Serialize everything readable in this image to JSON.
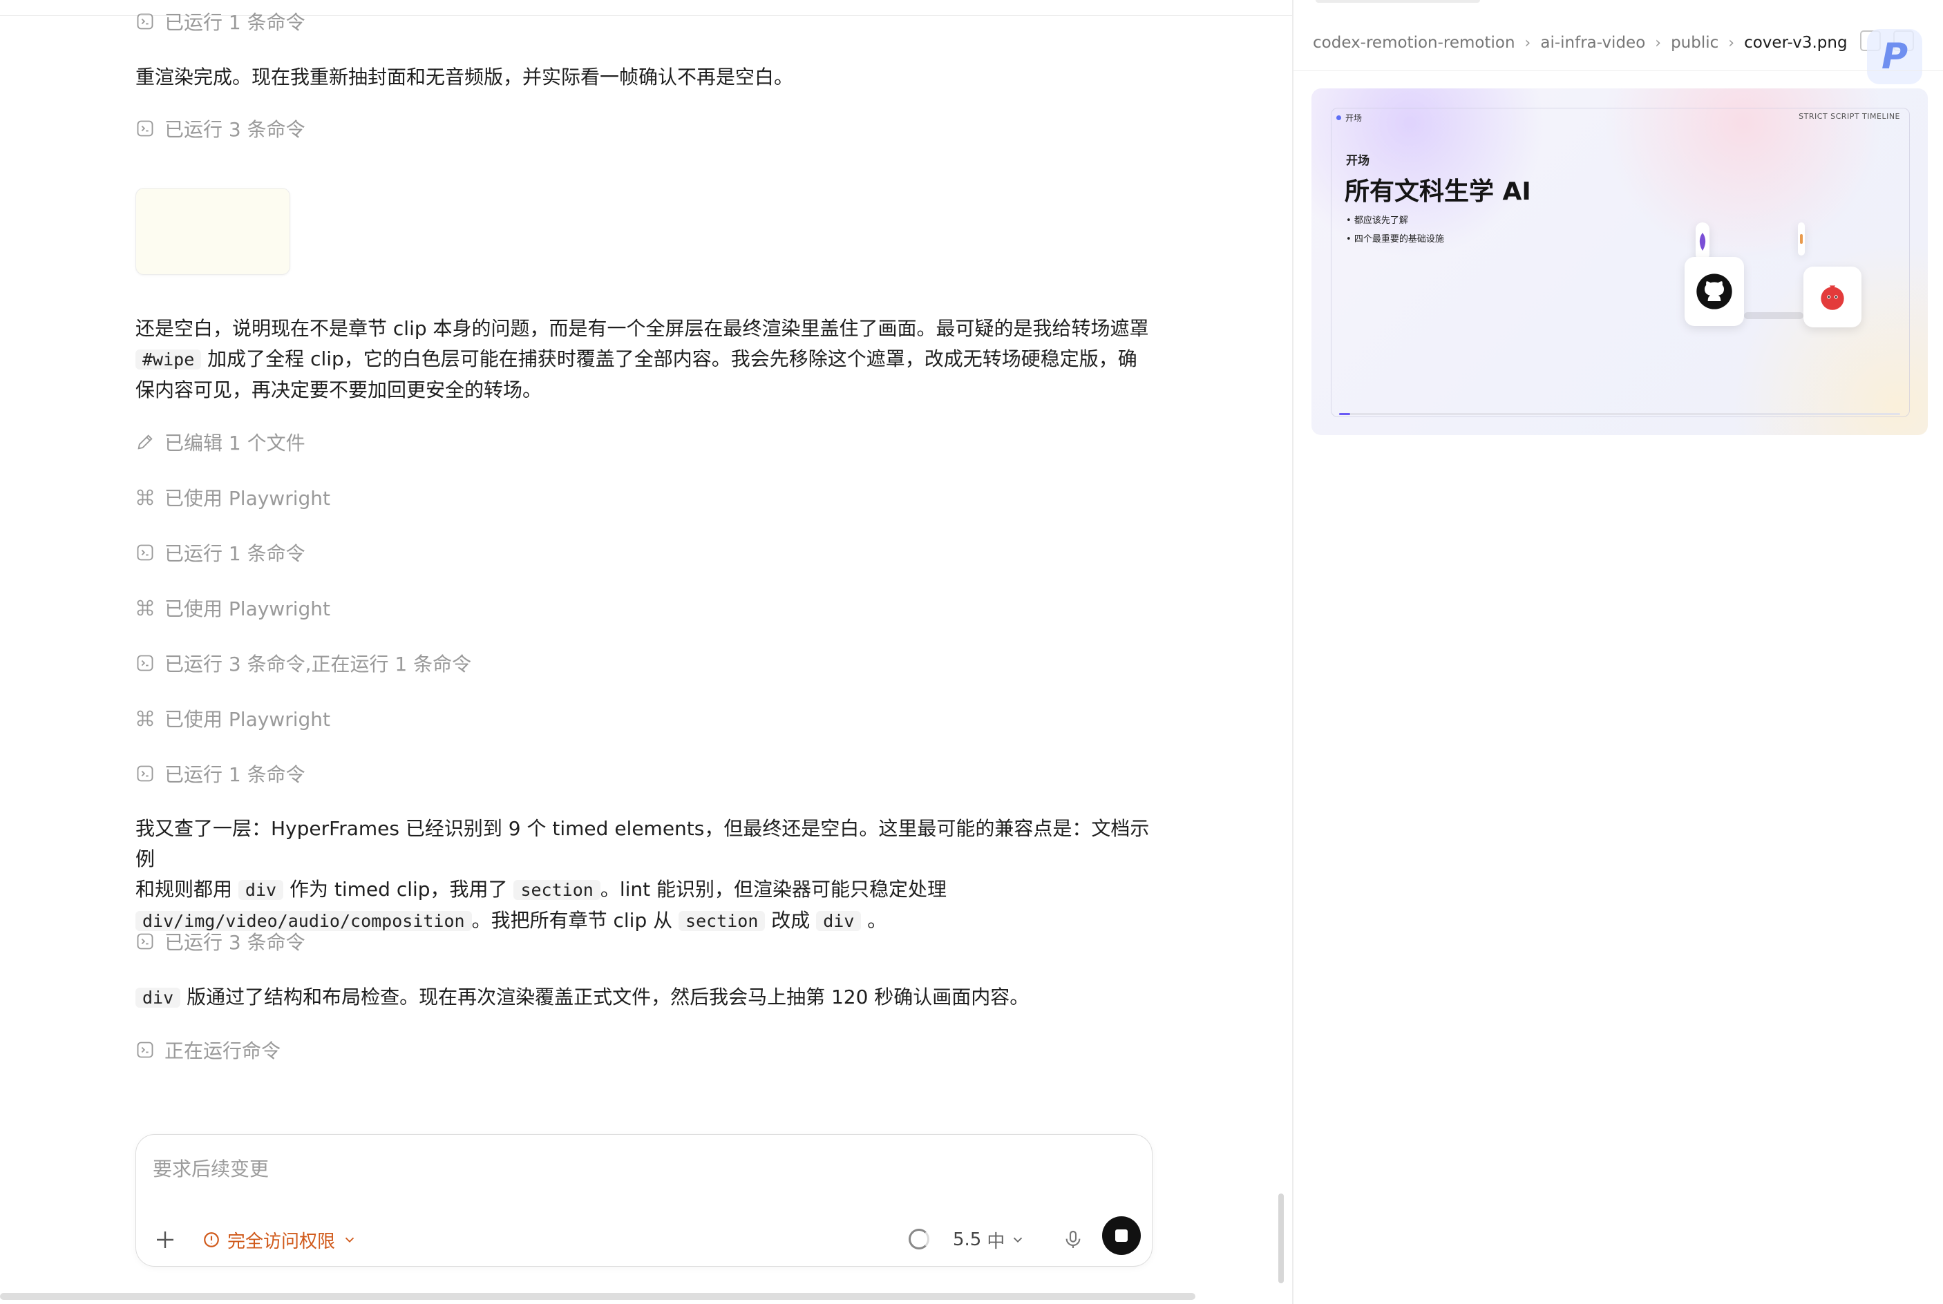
{
  "chat": {
    "top_action": "已运行 1 条命令",
    "msg1": "重渲染完成。现在我重新抽封面和无音频版，并实际看一帧确认不再是空白。",
    "act1": "已运行 3 条命令",
    "msg2": {
      "line1": "还是空白，说明现在不是章节 clip 本身的问题，而是有一个全屏层在最终渲染里盖住了画面。最可疑的是我给转场遮罩",
      "code1": "#wipe",
      "line2": "加成了全程 clip，它的白色层可能在捕获时覆盖了全部内容。我会先移除这个遮罩，改成无转场硬稳定版，确",
      "line3": "保内容可见，再决定要不要加回更安全的转场。"
    },
    "actions": [
      {
        "icon": "pencil-icon",
        "label": "已编辑 1 个文件"
      },
      {
        "icon": "command-icon",
        "label": "已使用 Playwright"
      },
      {
        "icon": "terminal-icon",
        "label": "已运行 1 条命令"
      },
      {
        "icon": "command-icon",
        "label": "已使用 Playwright"
      },
      {
        "icon": "terminal-icon",
        "label": "已运行 3 条命令,正在运行 1 条命令"
      },
      {
        "icon": "command-icon",
        "label": "已使用 Playwright"
      },
      {
        "icon": "terminal-icon",
        "label": "已运行 1 条命令"
      }
    ],
    "msg3": {
      "t1": "我又查了一层：HyperFrames 已经识别到 9 个 timed elements，但最终还是空白。这里最可能的兼容点是：文档示例",
      "t2": "和规则都用",
      "c1": "div",
      "t3": "作为 timed clip，我用了",
      "c2": "section",
      "t4": "。lint 能识别，但渲染器可能只稳定处理",
      "c3": "div/img/video/audio/composition",
      "t5": "。我把所有章节 clip 从",
      "c4": "section",
      "t6": "改成",
      "c5": "div",
      "t7": "。"
    },
    "act2": "已运行 3 条命令",
    "msg4": {
      "code": "div",
      "text": "版通过了结构和布局检查。现在再次渲染覆盖正式文件，然后我会马上抽第 120 秒确认画面内容。"
    },
    "act3": "正在运行命令"
  },
  "composer": {
    "placeholder": "要求后续变更",
    "permission": "完全访问权限",
    "model": "5.5",
    "effort": "中"
  },
  "preview": {
    "breadcrumbs": [
      "codex-remotion-remotion",
      "ai-infra-video",
      "public",
      "cover-v3.png"
    ],
    "badge": "P",
    "cover": {
      "tag": "开场",
      "timeline": "STRICT SCRIPT TIMELINE",
      "kicker": "开场",
      "title": "所有文科生学 AI",
      "bullets": [
        "都应该先了解",
        "四个最重要的基础设施"
      ],
      "progress": 0.02
    }
  },
  "colors": {
    "accent_orange": "#d0591a",
    "muted_text": "#9a9a9a",
    "progress_purple": "#6a5af5"
  }
}
